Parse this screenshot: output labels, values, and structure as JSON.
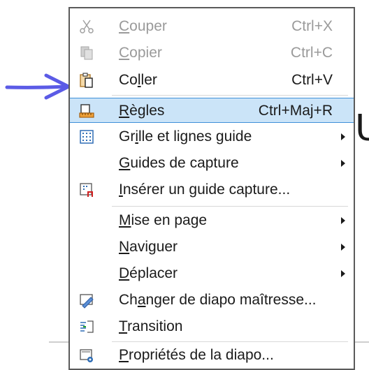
{
  "menu": {
    "items": [
      {
        "pre": "",
        "key": "C",
        "post": "ouper",
        "shortcut": "Ctrl+X",
        "icon": "scissors-icon",
        "disabled": true,
        "submenu": false
      },
      {
        "pre": "",
        "key": "C",
        "post": "opier",
        "shortcut": "Ctrl+C",
        "icon": "copy-icon",
        "disabled": true,
        "submenu": false
      },
      {
        "pre": "Co",
        "key": "l",
        "post": "ler",
        "shortcut": "Ctrl+V",
        "icon": "clipboard-icon",
        "disabled": false,
        "submenu": false
      },
      {
        "pre": "",
        "key": "R",
        "post": "ègles",
        "shortcut": "Ctrl+Maj+R",
        "icon": "ruler-icon",
        "disabled": false,
        "submenu": false,
        "highlight": true
      },
      {
        "pre": "Gr",
        "key": "i",
        "post": "lle et lignes guide",
        "shortcut": "",
        "icon": "grid-icon",
        "disabled": false,
        "submenu": true
      },
      {
        "pre": "",
        "key": "G",
        "post": "uides de capture",
        "shortcut": "",
        "icon": "",
        "disabled": false,
        "submenu": true
      },
      {
        "pre": "",
        "key": "I",
        "post": "nsérer un guide capture...",
        "shortcut": "",
        "icon": "insert-snap-guide-icon",
        "disabled": false,
        "submenu": false
      },
      {
        "pre": "",
        "key": "M",
        "post": "ise en page",
        "shortcut": "",
        "icon": "",
        "disabled": false,
        "submenu": true
      },
      {
        "pre": "",
        "key": "N",
        "post": "aviguer",
        "shortcut": "",
        "icon": "",
        "disabled": false,
        "submenu": true
      },
      {
        "pre": "",
        "key": "D",
        "post": "éplacer",
        "shortcut": "",
        "icon": "",
        "disabled": false,
        "submenu": true
      },
      {
        "pre": "Ch",
        "key": "a",
        "post": "nger de diapo maîtresse...",
        "shortcut": "",
        "icon": "change-master-slide-icon",
        "disabled": false,
        "submenu": false
      },
      {
        "pre": "",
        "key": "T",
        "post": "ransition",
        "shortcut": "",
        "icon": "transition-icon",
        "disabled": false,
        "submenu": false
      },
      {
        "pre": "",
        "key": "P",
        "post": "ropriétés de la diapo...",
        "shortcut": "",
        "icon": "slide-properties-icon",
        "disabled": false,
        "submenu": false
      }
    ]
  },
  "background": {
    "partial_letter": "U"
  },
  "annotation": {
    "arrow_color": "#5b5be6"
  }
}
